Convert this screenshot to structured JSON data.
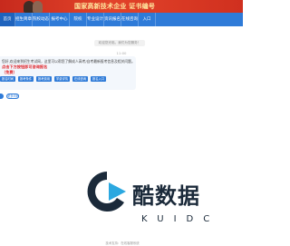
{
  "banner": {
    "title": "国家高新技术企业 证书编号"
  },
  "nav": {
    "items": [
      {
        "label": "首页"
      },
      {
        "label": "招生简章"
      },
      {
        "label": "院校动态"
      },
      {
        "label": "报考中心"
      },
      {
        "label": "院校"
      },
      {
        "label": "专业设计"
      },
      {
        "label": "资讯报名"
      },
      {
        "label": "在线咨询"
      },
      {
        "label": "入口"
      }
    ]
  },
  "chat": {
    "notice": "欢迎您光临，我们为您服务！",
    "time": "11:00",
    "message": {
      "line1": "您好,欢迎来到招生考试网，这里可以帮您了解成人高考/自考最新报考信息及相关问题。",
      "line2": "点击下方按钮即可咨询报名",
      "line3": "（免费）"
    },
    "quick_buttons": [
      {
        "label": "报名时间"
      },
      {
        "label": "报考条件"
      },
      {
        "label": "报考费用"
      },
      {
        "label": "学费详情"
      },
      {
        "label": "在线咨询"
      },
      {
        "label": "报名入口"
      }
    ],
    "more_link": "更多问题"
  },
  "watermark": {
    "brand": "酷数据",
    "sub": "KUIDC"
  },
  "footer": "技术支持：在线客服系统"
}
